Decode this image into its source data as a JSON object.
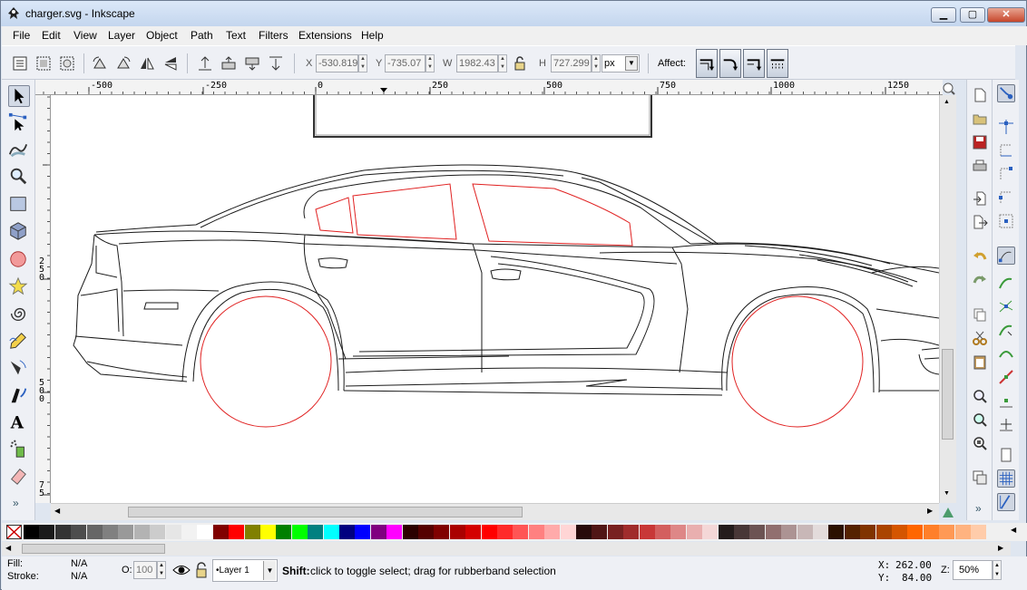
{
  "window": {
    "title": "charger.svg - Inkscape"
  },
  "menu": [
    {
      "label": "File"
    },
    {
      "label": "Edit"
    },
    {
      "label": "View"
    },
    {
      "label": "Layer"
    },
    {
      "label": "Object"
    },
    {
      "label": "Path"
    },
    {
      "label": "Text"
    },
    {
      "label": "Filters"
    },
    {
      "label": "Extensions"
    },
    {
      "label": "Help"
    }
  ],
  "toolbar": {
    "x_label": "X",
    "x_value": "-530.819",
    "y_label": "Y",
    "y_value": "-735.07",
    "w_label": "W",
    "w_value": "1982.43",
    "h_label": "H",
    "h_value": "727.299",
    "unit": "px",
    "affect_label": "Affect:"
  },
  "ruler": {
    "top_ticks": [
      "-500",
      "-250",
      "0",
      "250",
      "500",
      "750",
      "1000",
      "1250"
    ],
    "left_ticks": [
      "2",
      "5",
      "0",
      "5",
      "0",
      "0",
      "7",
      "5"
    ]
  },
  "palette": {
    "colors": [
      "#000000",
      "#1a1a1a",
      "#333333",
      "#4d4d4d",
      "#666666",
      "#808080",
      "#999999",
      "#b3b3b3",
      "#cccccc",
      "#e6e6e6",
      "#f2f2f2",
      "#ffffff",
      "#800000",
      "#ff0000",
      "#808000",
      "#ffff00",
      "#008000",
      "#00ff00",
      "#008080",
      "#00ffff",
      "#000080",
      "#0000ff",
      "#800080",
      "#ff00ff",
      "#2b0000",
      "#550000",
      "#800000",
      "#aa0000",
      "#d40000",
      "#ff0000",
      "#ff2a2a",
      "#ff5555",
      "#ff8080",
      "#ffaaaa",
      "#ffd5d5",
      "#280b0b",
      "#501616",
      "#782121",
      "#a02c2c",
      "#c83737",
      "#d35f5f",
      "#de8787",
      "#e9afaf",
      "#f4d7d7",
      "#241c1c",
      "#483737",
      "#6c5353",
      "#916f6f",
      "#ac9393",
      "#c8b7b7",
      "#e3dbdb",
      "#2b1100",
      "#552200",
      "#803300",
      "#aa4400",
      "#d45500",
      "#ff6600",
      "#ff7f2a",
      "#ff9955",
      "#ffb380",
      "#ffccaa"
    ]
  },
  "status": {
    "fill_label": "Fill:",
    "fill_value": "N/A",
    "stroke_label": "Stroke:",
    "stroke_value": "N/A",
    "opacity_label": "O:",
    "opacity_value": "100",
    "layer": "•Layer 1",
    "message_bold": "Shift:",
    "message": " click to toggle select; drag for rubberband selection",
    "x_label": "X:",
    "x_value": "262.00",
    "y_label": "Y:",
    "y_value": "84.00",
    "zoom_label": "Z:",
    "zoom_value": "50%"
  }
}
